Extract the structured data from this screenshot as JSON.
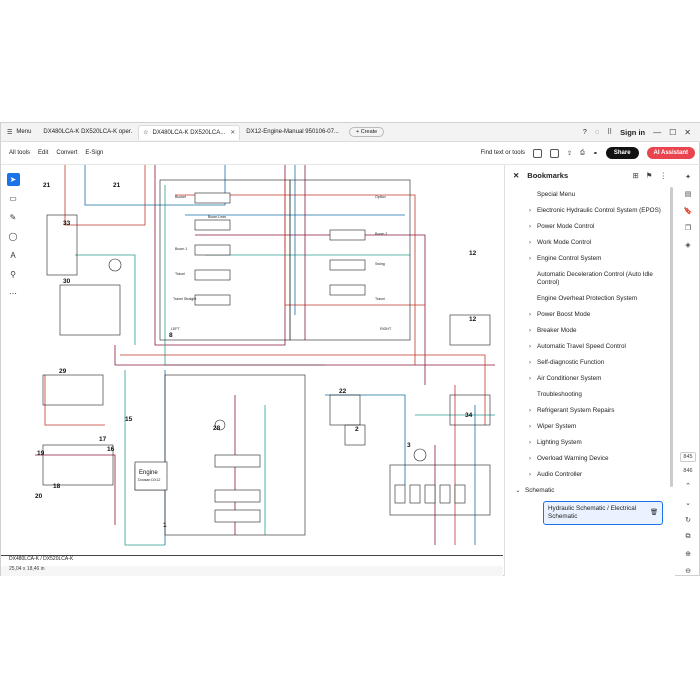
{
  "tabbar": {
    "menu_label": "Menu",
    "tabs": [
      {
        "label": "DX480LCA-K DX520LCA-K oper.",
        "active": false
      },
      {
        "label": "DX480LCA-K DX520LCA...",
        "active": true
      },
      {
        "label": "DX12-Engine-Manual 950106-07...",
        "active": false
      }
    ],
    "create_label": "Create",
    "signin_label": "Sign in"
  },
  "toolbar": {
    "items": [
      "All tools",
      "Edit",
      "Convert",
      "E-Sign"
    ],
    "find_label": "Find text or tools",
    "share_label": "Share",
    "ai_label": "AI Assistant"
  },
  "schematic": {
    "labels": {
      "n21a": "21",
      "n21b": "21",
      "n33": "33",
      "n30": "30",
      "n29": "29",
      "n15": "15",
      "n17": "17",
      "n16": "16",
      "n19": "19",
      "n18": "18",
      "n20": "20",
      "n28": "28",
      "n1": "1",
      "n22": "22",
      "n2": "2",
      "n3": "3",
      "n34": "34",
      "n12a": "12",
      "n12b": "12",
      "n8": "8",
      "engine": "Engine",
      "engine_sub": "Doosan DX12",
      "bucket": "Bucket",
      "boom_less": "Boom Less",
      "boom1": "Boom 1",
      "travel": "Travel",
      "travel_straight": "Travel Straight",
      "left": "LEFT",
      "right": "RIGHT",
      "option": "Option",
      "boom2": "Boom 2",
      "swing": "Swing",
      "travel_r": "Travel"
    }
  },
  "page_footer": "DX480LCA-K / DX520LCA-K",
  "status_text": "25,04 x 18,46 in",
  "bookmarks": {
    "title": "Bookmarks",
    "items": [
      {
        "label": "Special Menu",
        "chevron": false
      },
      {
        "label": "Electronic Hydraulic Control System (EPOS)",
        "chevron": true
      },
      {
        "label": "Power Mode Control",
        "chevron": true
      },
      {
        "label": "Work Mode Control",
        "chevron": true
      },
      {
        "label": "Engine Control System",
        "chevron": true
      },
      {
        "label": "Automatic Deceleration Control (Auto Idle Control)",
        "chevron": false
      },
      {
        "label": "Engine Overheat Protection System",
        "chevron": false
      },
      {
        "label": "Power Boost Mode",
        "chevron": true
      },
      {
        "label": "Breaker Mode",
        "chevron": true
      },
      {
        "label": "Automatic Travel Speed Control",
        "chevron": true
      },
      {
        "label": "Self-diagnostic Function",
        "chevron": true
      },
      {
        "label": "Air Conditioner System",
        "chevron": true
      },
      {
        "label": "Troubleshooting",
        "chevron": false
      },
      {
        "label": "Refrigerant System Repairs",
        "chevron": true
      },
      {
        "label": "Wiper System",
        "chevron": true
      },
      {
        "label": "Lighting System",
        "chevron": true
      },
      {
        "label": "Overload Warning Device",
        "chevron": true
      },
      {
        "label": "Audio Controller",
        "chevron": true
      }
    ],
    "section_label": "Schematic",
    "selected_label": "Hydraulic Schematic / Electrical Schematic"
  },
  "page_nav": {
    "current": "845",
    "total": "846"
  }
}
